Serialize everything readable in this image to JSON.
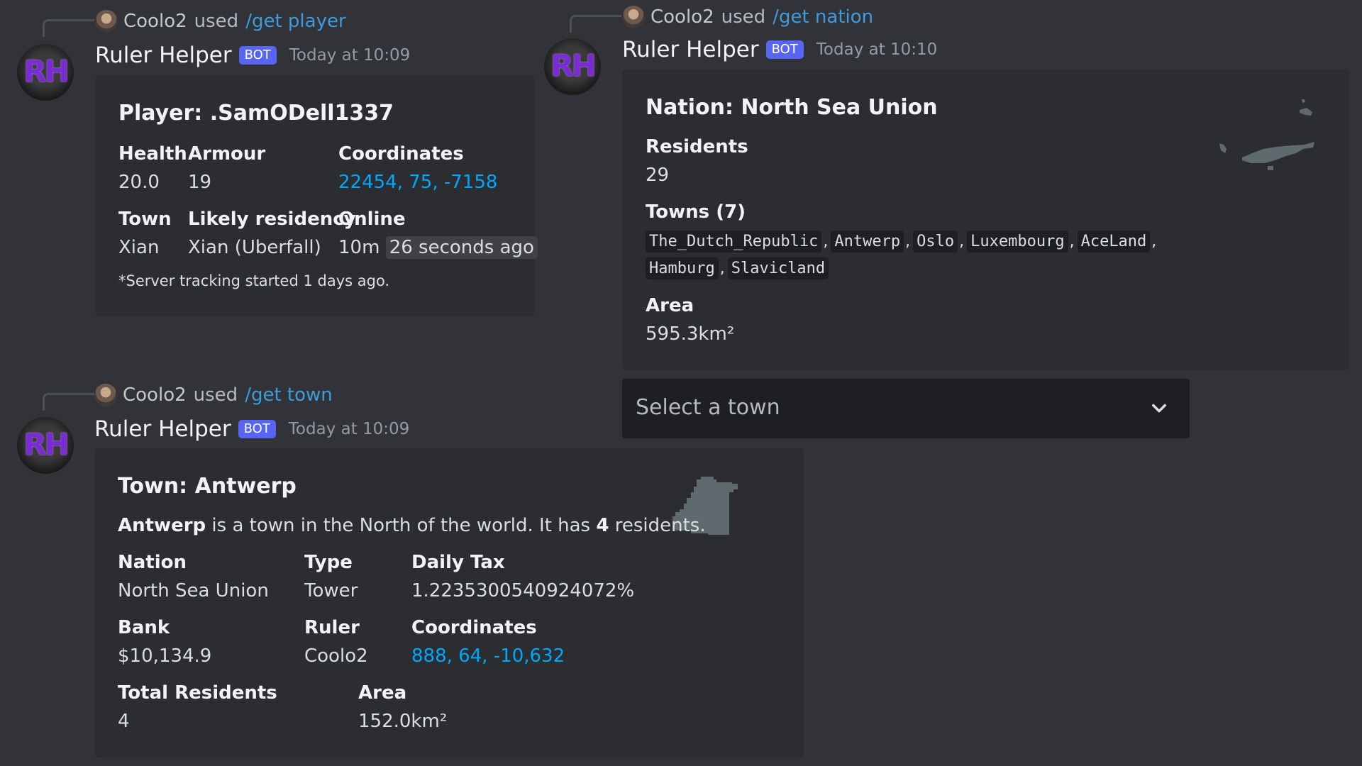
{
  "colors": {
    "background": "#313338",
    "embed": "#2b2d31",
    "link": "#00a8fc",
    "badge": "#5865f2",
    "avatar_letters": "#7b2bd6"
  },
  "bot": {
    "name": "Ruler Helper",
    "badge": "BOT",
    "avatar_text": "RH"
  },
  "messages": {
    "player": {
      "reply": {
        "user": "Coolo2",
        "used": "used",
        "command": "/get player"
      },
      "timestamp": "Today at 10:09",
      "title": "Player: .SamODell1337",
      "fields": {
        "health": {
          "name": "Health",
          "value": "20.0"
        },
        "armour": {
          "name": "Armour",
          "value": "19"
        },
        "coordinates": {
          "name": "Coordinates",
          "value": "22454, 75, -7158"
        },
        "town": {
          "name": "Town",
          "value": "Xian"
        },
        "residency": {
          "name": "Likely residency",
          "value": "Xian (Uberfall)"
        },
        "online": {
          "name": "Online",
          "value": "10m",
          "relative": "26 seconds ago"
        }
      },
      "footnote": "*Server tracking started 1 days ago."
    },
    "nation": {
      "reply": {
        "user": "Coolo2",
        "used": "used",
        "command": "/get nation"
      },
      "timestamp": "Today at 10:10",
      "title": "Nation: North Sea Union",
      "fields": {
        "residents": {
          "name": "Residents",
          "value": "29"
        },
        "towns": {
          "name": "Towns (7)",
          "items": [
            "The_Dutch_Republic",
            "Antwerp",
            "Oslo",
            "Luxembourg",
            "AceLand",
            "Hamburg",
            "Slavicland"
          ]
        },
        "area": {
          "name": "Area",
          "value": "595.3km²"
        }
      },
      "select": {
        "placeholder": "Select a town",
        "icon": "chevron-down-icon"
      }
    },
    "town": {
      "reply": {
        "user": "Coolo2",
        "used": "used",
        "command": "/get town"
      },
      "timestamp": "Today at 10:09",
      "title": "Town: Antwerp",
      "description": {
        "name": "Antwerp",
        "middle": " is a town in the North of the world. It has ",
        "count": "4",
        "end": " residents."
      },
      "fields": {
        "nation": {
          "name": "Nation",
          "value": "North Sea Union"
        },
        "type": {
          "name": "Type",
          "value": "Tower"
        },
        "tax": {
          "name": "Daily Tax",
          "value": "1.2235300540924072%"
        },
        "bank": {
          "name": "Bank",
          "value": "$10,134.9"
        },
        "ruler": {
          "name": "Ruler",
          "value": "Coolo2"
        },
        "coordinates": {
          "name": "Coordinates",
          "value": "888, 64, -10,632"
        },
        "total_residents": {
          "name": "Total Residents",
          "value": "4"
        },
        "area": {
          "name": "Area",
          "value": "152.0km²"
        }
      }
    }
  }
}
